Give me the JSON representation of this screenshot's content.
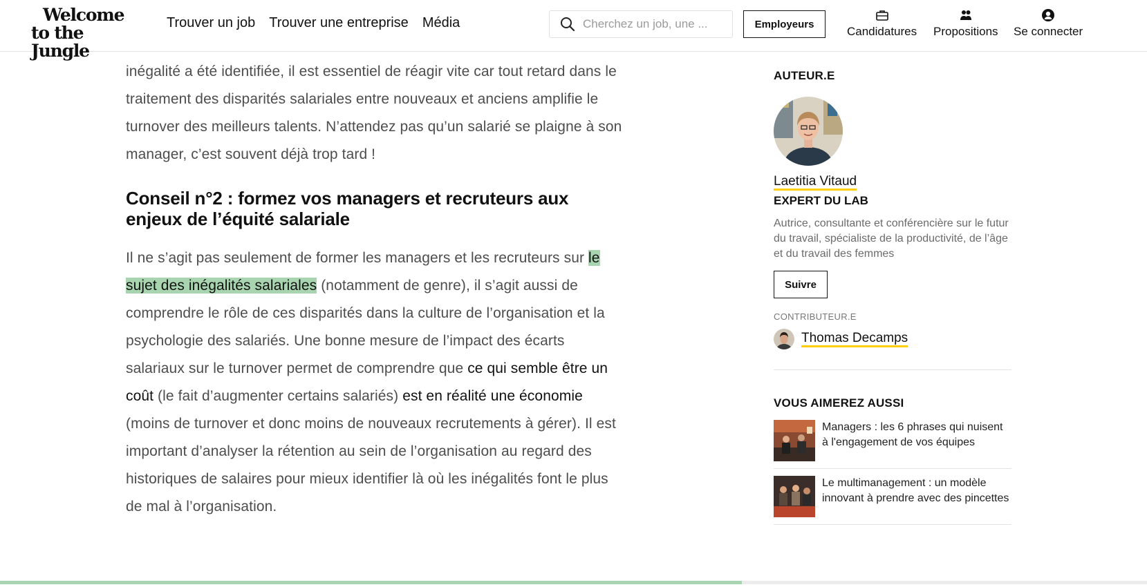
{
  "header": {
    "logo_line1": "Welcome",
    "logo_line2": "to the Jungle",
    "nav": [
      "Trouver un job",
      "Trouver une entreprise",
      "Média"
    ],
    "search_placeholder": "Cherchez un job, une ...",
    "employeurs_label": "Employeurs",
    "candidatures_label": "Candidatures",
    "propositions_label": "Propositions",
    "connecter_label": "Se connecter"
  },
  "article": {
    "p1": "inégalité a été identifiée, il est essentiel de réagir vite car tout retard dans le traitement des disparités salariales entre nouveaux et anciens amplifie le turnover des meilleurs talents. N’attendez pas qu’un salarié se plaigne à son manager, c’est souvent déjà trop tard !",
    "h2": "Conseil n°2 : formez vos managers et recruteurs aux enjeux de l’équité salariale",
    "p2_a": "Il ne s’agit pas seulement de former les managers et les recruteurs sur ",
    "p2_link": "le sujet des inégalités salariales",
    "p2_b": " (notamment de genre), il s’agit aussi de comprendre le rôle de ces disparités dans la culture de l’organisation et la psychologie des salariés. Une bonne mesure de l’impact des écarts salariaux sur le turnover permet de comprendre que ",
    "p2_bold1": "ce qui semble être un coût",
    "p2_c": " (le fait d’augmenter certains salariés) ",
    "p2_bold2": "est en réalité une économie",
    "p2_d": " (moins de turnover et donc moins de nouveaux recrutements à gérer). Il est important d’analyser la rétention au sein de l’organisation au regard des historiques de salaires pour mieux identifier là où les inégalités font le plus de mal à l’organisation."
  },
  "sidebar": {
    "author_title": "AUTEUR.E",
    "author_name": "Laetitia Vitaud",
    "author_role": "EXPERT DU LAB",
    "author_bio": "Autrice, consultante et conférencière sur le futur du travail, spécialiste de la productivité, de l’âge et du travail des femmes",
    "follow_label": "Suivre",
    "contributor_title": "CONTRIBUTEUR.E",
    "contributor_name": "Thomas Decamps",
    "related_title": "VOUS AIMEREZ AUSSI",
    "related": [
      {
        "title": "Managers : les 6 phrases qui nuisent à l'engagement de vos équipes"
      },
      {
        "title": "Le multimanagement : un modèle innovant à prendre avec des pincettes"
      }
    ]
  },
  "progress": {
    "fraction": 0.647,
    "color": "#a8d5b0"
  },
  "colors": {
    "accent_underline": "#ffcd00",
    "highlight": "#a8d5b0"
  },
  "icons": [
    "search-icon",
    "briefcase-icon",
    "users-icon",
    "user-circle-icon"
  ]
}
